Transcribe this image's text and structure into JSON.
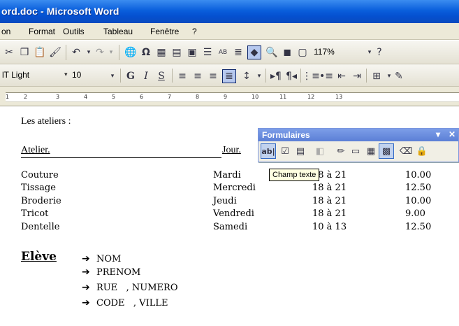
{
  "window": {
    "title": "ord.doc - Microsoft Word"
  },
  "menu": {
    "items": [
      "on",
      "Format",
      "Outils",
      "Tableau",
      "Fenêtre",
      "?"
    ]
  },
  "toolbar": {
    "zoom": "117%",
    "font_name": "lT Light",
    "font_size": "10",
    "bold_label": "G",
    "italic_label": "I",
    "underline_label": "S"
  },
  "ruler": {
    "ticks": [
      "1",
      "2",
      "3",
      "4",
      "5",
      "6",
      "7",
      "8",
      "9",
      "10",
      "11",
      "12",
      "13"
    ]
  },
  "document": {
    "heading": "Les ateliers :",
    "columns": {
      "atelier": "Atelier.",
      "jour": "Jour."
    },
    "rows": [
      {
        "atelier": "Couture",
        "jour": "Mardi",
        "heures": "18 à 21",
        "prix": "10.00"
      },
      {
        "atelier": "Tissage",
        "jour": "Mercredi",
        "heures": "18 à 21",
        "prix": "12.50"
      },
      {
        "atelier": "Broderie",
        "jour": "Jeudi",
        "heures": "18 à 21",
        "prix": "10.00"
      },
      {
        "atelier": "Tricot",
        "jour": "Vendredi",
        "heures": "18 à 21",
        "prix": "9.00"
      },
      {
        "atelier": "Dentelle",
        "jour": "Samedi",
        "heures": "10 à 13",
        "prix": "12.50"
      }
    ],
    "eleve": {
      "label": "Elève",
      "fields": [
        "NOM",
        "PRENOM",
        "RUE   , NUMERO",
        "CODE   , VILLE"
      ]
    }
  },
  "forms_toolbar": {
    "title": "Formulaires",
    "text_field_label": "ab|",
    "tooltip": "Champ texte"
  },
  "colors": {
    "titlebar": "#0a5fdc",
    "chrome": "#ece9d8",
    "forms_header": "#5b7fd6",
    "tooltip_bg": "#ffffe1"
  }
}
